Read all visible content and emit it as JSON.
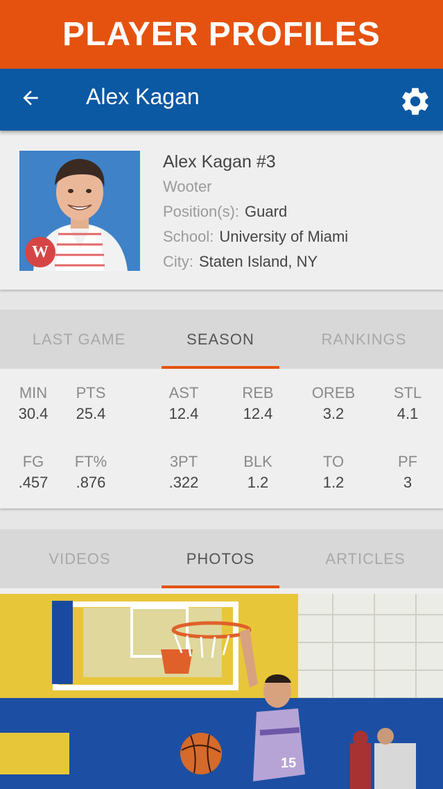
{
  "banner": {
    "title": "PLAYER PROFILES"
  },
  "appbar": {
    "title": "Alex Kagan",
    "back_icon": "arrow-back-icon",
    "settings_icon": "gear-icon"
  },
  "colors": {
    "accent": "#e5520f",
    "brand": "#0b58a3"
  },
  "profile": {
    "name": "Alex Kagan #3",
    "team": "Wooter",
    "position_label": "Position(s):",
    "position": "Guard",
    "school_label": "School:",
    "school": "University of Miami",
    "city_label": "City:",
    "city": "Staten Island, NY",
    "badge": "W"
  },
  "stat_tabs": [
    {
      "label": "LAST GAME",
      "active": false
    },
    {
      "label": "SEASON",
      "active": true
    },
    {
      "label": "RANKINGS",
      "active": false
    }
  ],
  "stats": [
    {
      "label": "MIN",
      "value": "30.4"
    },
    {
      "label": "PTS",
      "value": "25.4"
    },
    {
      "label": "AST",
      "value": "12.4"
    },
    {
      "label": "REB",
      "value": "12.4"
    },
    {
      "label": "OREB",
      "value": "3.2"
    },
    {
      "label": "STL",
      "value": "4.1"
    },
    {
      "label": "FG",
      "value": ".457"
    },
    {
      "label": "FT%",
      "value": ".876"
    },
    {
      "label": "3PT",
      "value": ".322"
    },
    {
      "label": "BLK",
      "value": "1.2"
    },
    {
      "label": "TO",
      "value": "1.2"
    },
    {
      "label": "PF",
      "value": "3"
    }
  ],
  "media_tabs": [
    {
      "label": "VIDEOS",
      "active": false
    },
    {
      "label": "PHOTOS",
      "active": true
    },
    {
      "label": "ARTICLES",
      "active": false
    }
  ]
}
